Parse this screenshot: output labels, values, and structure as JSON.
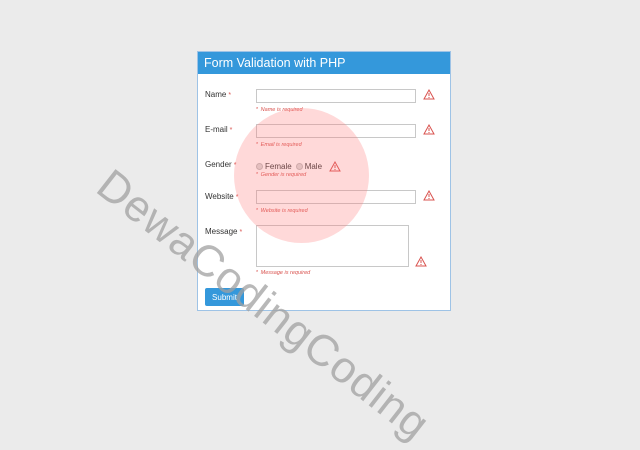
{
  "form": {
    "title": "Form Validation with PHP",
    "required_mark": "*",
    "fields": {
      "name": {
        "label": "Name",
        "value": "",
        "error": "Name is required"
      },
      "email": {
        "label": "E-mail",
        "value": "",
        "error": "Email is required"
      },
      "gender": {
        "label": "Gender",
        "options": [
          "Female",
          "Male"
        ],
        "error": "Gender is required"
      },
      "website": {
        "label": "Website",
        "value": "",
        "error": "Website is required"
      },
      "message": {
        "label": "Message",
        "value": "",
        "error": "Message is required"
      }
    },
    "submit_label": "Submit",
    "icons": {
      "warning": "warning-triangle-icon"
    },
    "colors": {
      "header": "#3498db",
      "error": "#d9534f",
      "button": "#3498db"
    }
  },
  "watermark": {
    "text": "DewaCodingCoding"
  }
}
